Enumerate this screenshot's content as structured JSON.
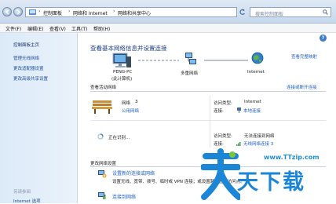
{
  "address": {
    "crumbs": [
      "控制面板",
      "网络和 Internet",
      "网络和共享中心"
    ],
    "search_placeholder": "搜索控制面板"
  },
  "menu": [
    "文件(F)",
    "编辑(E)",
    "查看(V)",
    "工具(T)",
    "帮助(H)"
  ],
  "sidebar": {
    "home": "控制面板主页",
    "links": [
      "管理无线网络",
      "更改适配器设置",
      "更改高级共享设置"
    ],
    "see_also": "另请参阅",
    "bottom": "Internet 选项"
  },
  "main": {
    "title": "查看基本网络信息并设置连接",
    "full_map": "查看完整映射",
    "map": {
      "pc_name": "PENG-PC",
      "pc_sub": "(此计算机)",
      "middle": "多重网络",
      "internet": "Internet"
    },
    "active_header": "查看活动网络",
    "connect_link": "连接或断开连接",
    "net1": {
      "name": "网络",
      "num": "3",
      "type": "公用网络",
      "access_label": "访问类型:",
      "access_value": "Internet",
      "conn_label": "连接:",
      "conn_value": "本地连接"
    },
    "net2": {
      "status": "正在识别...",
      "access_label": "访问类型:",
      "access_value": "无法连接到网络",
      "conn_label": "连接:",
      "conn_value": "无线网络连接 3"
    },
    "settings_header": "更改网络设置",
    "settings": [
      {
        "title": "设置新的连接或网络",
        "desc": "设置无线、宽带、拨号、临时或 VPN 连接；或设置路由器或访问点。"
      },
      {
        "title": "连接到网络",
        "desc": ""
      }
    ]
  },
  "watermark": {
    "url": "www.TTzip.com",
    "brand": "天下载"
  }
}
